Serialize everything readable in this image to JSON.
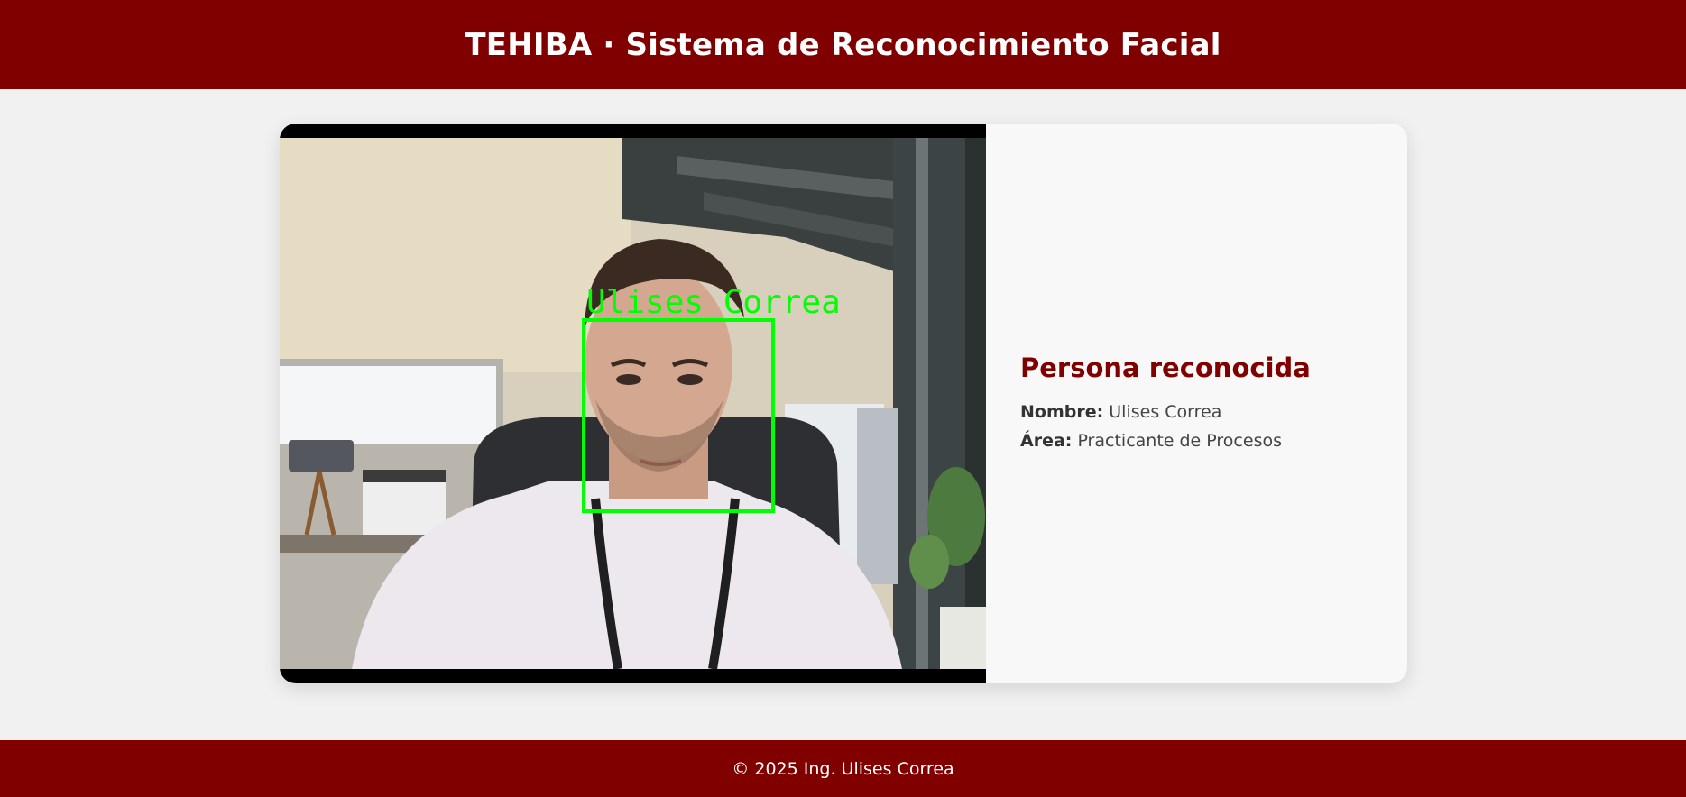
{
  "header": {
    "title": "TEHIBA · Sistema de Reconocimiento Facial"
  },
  "camera": {
    "face_label": "Ulises Correa",
    "box_color": "#00ff00"
  },
  "info": {
    "heading": "Persona reconocida",
    "name_label": "Nombre:",
    "name_value": "Ulises Correa",
    "area_label": "Área:",
    "area_value": "Practicante de Procesos"
  },
  "footer": {
    "text": "© 2025 Ing. Ulises Correa"
  },
  "colors": {
    "brand": "#800000",
    "background": "#f1f1f1",
    "card": "#f8f8f8"
  }
}
